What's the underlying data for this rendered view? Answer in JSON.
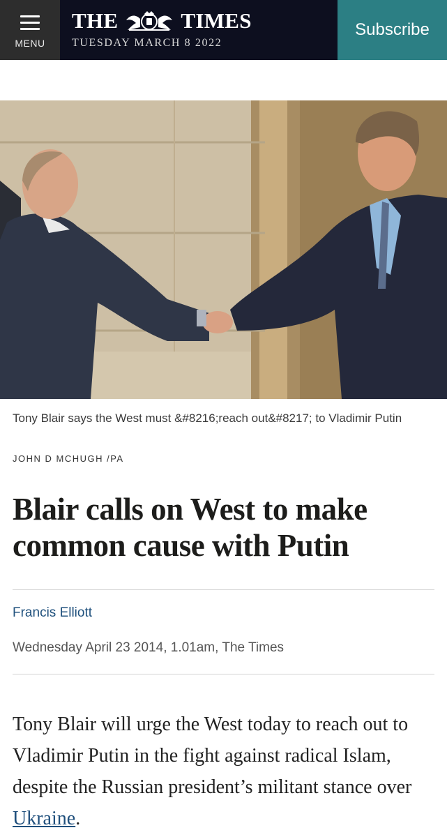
{
  "header": {
    "menu_label": "MENU",
    "masthead_left": "THE",
    "masthead_right": "TIMES",
    "date": "TUESDAY MARCH 8 2022",
    "subscribe_label": "Subscribe"
  },
  "photo": {
    "caption": "Tony Blair says the West must &#8216;reach out&#8217; to Vladimir Putin",
    "credit": "JOHN D MCHUGH /PA"
  },
  "article": {
    "headline": "Blair calls on West to make common cause with Putin",
    "author": "Francis Elliott",
    "dateline": "Wednesday April 23 2014, 1.01am, The Times",
    "body_before": "Tony Blair will urge the West today to reach out to Vladimir Putin in the fight against radical Islam, despite the Russian president’s militant stance over ",
    "body_link": "Ukraine",
    "body_after": "."
  },
  "colors": {
    "header_bg": "#0d0f1f",
    "menu_bg": "#2d2d2d",
    "subscribe_bg": "#2c7f84",
    "author_link": "#20517d"
  },
  "icons": [
    "hamburger-menu-icon",
    "royal-crest-icon"
  ]
}
